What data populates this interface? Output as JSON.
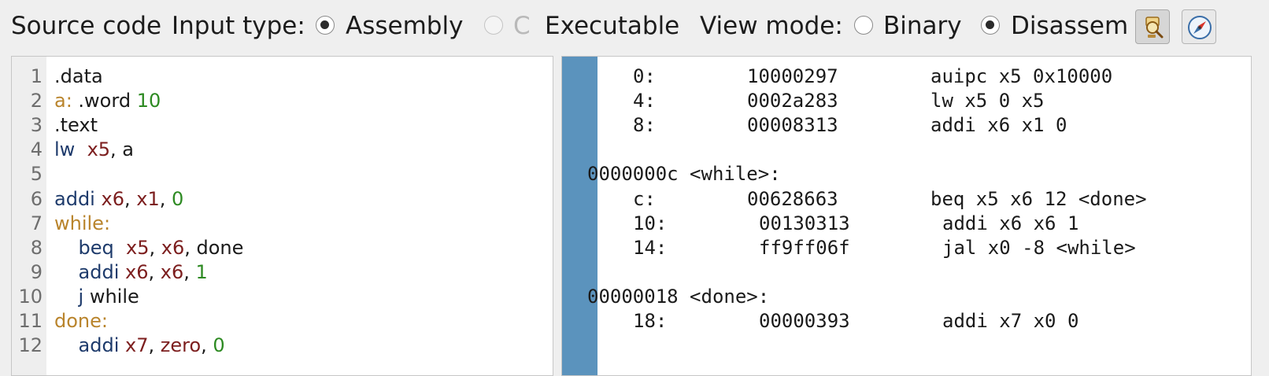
{
  "toolbar": {
    "source_code_label": "Source code",
    "input_type_label": "Input type:",
    "input_types": [
      {
        "label": "Assembly",
        "checked": true,
        "disabled": false
      },
      {
        "label": "C",
        "checked": false,
        "disabled": true
      },
      {
        "label": "Executable",
        "checked": false,
        "disabled": false
      }
    ],
    "view_mode_label": "View mode:",
    "view_modes": [
      {
        "label": "Binary",
        "checked": false
      },
      {
        "label": "Disassembly",
        "checked": true
      }
    ],
    "buttons": [
      {
        "icon": "bug-search-icon"
      },
      {
        "icon": "compass-icon"
      }
    ]
  },
  "editor": {
    "line_numbers": [
      "1",
      "2",
      "3",
      "4",
      "5",
      "6",
      "7",
      "8",
      "9",
      "10",
      "11",
      "12"
    ],
    "lines": [
      [
        {
          "t": ".data",
          "c": "plain"
        }
      ],
      [
        {
          "t": "a:",
          "c": "label"
        },
        {
          "t": " .word ",
          "c": "plain"
        },
        {
          "t": "10",
          "c": "num"
        }
      ],
      [
        {
          "t": ".text",
          "c": "plain"
        }
      ],
      [
        {
          "t": "lw",
          "c": "kw"
        },
        {
          "t": "  ",
          "c": "plain"
        },
        {
          "t": "x5",
          "c": "reg"
        },
        {
          "t": ", a",
          "c": "plain"
        }
      ],
      [],
      [
        {
          "t": "addi",
          "c": "kw"
        },
        {
          "t": " ",
          "c": "plain"
        },
        {
          "t": "x6",
          "c": "reg"
        },
        {
          "t": ", ",
          "c": "plain"
        },
        {
          "t": "x1",
          "c": "reg"
        },
        {
          "t": ", ",
          "c": "plain"
        },
        {
          "t": "0",
          "c": "num"
        }
      ],
      [
        {
          "t": "while:",
          "c": "label"
        }
      ],
      [
        {
          "t": "    ",
          "c": "plain"
        },
        {
          "t": "beq",
          "c": "kw"
        },
        {
          "t": "  ",
          "c": "plain"
        },
        {
          "t": "x5",
          "c": "reg"
        },
        {
          "t": ", ",
          "c": "plain"
        },
        {
          "t": "x6",
          "c": "reg"
        },
        {
          "t": ", done",
          "c": "plain"
        }
      ],
      [
        {
          "t": "    ",
          "c": "plain"
        },
        {
          "t": "addi",
          "c": "kw"
        },
        {
          "t": " ",
          "c": "plain"
        },
        {
          "t": "x6",
          "c": "reg"
        },
        {
          "t": ", ",
          "c": "plain"
        },
        {
          "t": "x6",
          "c": "reg"
        },
        {
          "t": ", ",
          "c": "plain"
        },
        {
          "t": "1",
          "c": "num"
        }
      ],
      [
        {
          "t": "    ",
          "c": "plain"
        },
        {
          "t": "j",
          "c": "kw"
        },
        {
          "t": " while",
          "c": "plain"
        }
      ],
      [
        {
          "t": "done:",
          "c": "label"
        }
      ],
      [
        {
          "t": "    ",
          "c": "plain"
        },
        {
          "t": "addi",
          "c": "kw"
        },
        {
          "t": " ",
          "c": "plain"
        },
        {
          "t": "x7",
          "c": "reg"
        },
        {
          "t": ", ",
          "c": "plain"
        },
        {
          "t": "zero",
          "c": "reg"
        },
        {
          "t": ", ",
          "c": "plain"
        },
        {
          "t": "0",
          "c": "num"
        }
      ]
    ]
  },
  "disassembly": {
    "rows": [
      {
        "type": "instr",
        "addr": "0:",
        "hex": "10000297",
        "asm": "auipc x5 0x10000"
      },
      {
        "type": "instr",
        "addr": "4:",
        "hex": "0002a283",
        "asm": "lw x5 0 x5"
      },
      {
        "type": "instr",
        "addr": "8:",
        "hex": "00008313",
        "asm": "addi x6 x1 0"
      },
      {
        "type": "blank"
      },
      {
        "type": "label",
        "text": "0000000c <while>:"
      },
      {
        "type": "instr",
        "addr": "c:",
        "hex": "00628663",
        "asm": "beq x5 x6 12 <done>"
      },
      {
        "type": "instr",
        "addr": "10:",
        "hex": "00130313",
        "asm": "addi x6 x6 1"
      },
      {
        "type": "instr",
        "addr": "14:",
        "hex": "ff9ff06f",
        "asm": "jal x0 -8 <while>"
      },
      {
        "type": "blank"
      },
      {
        "type": "label",
        "text": "00000018 <done>:"
      },
      {
        "type": "instr",
        "addr": "18:",
        "hex": "00000393",
        "asm": "addi x7 x0 0"
      }
    ]
  },
  "colors": {
    "keyword": "#1d3a6b",
    "register": "#7c1e1e",
    "number": "#2d8a22",
    "label": "#b9842c",
    "sidebar": "#5b93bd"
  }
}
